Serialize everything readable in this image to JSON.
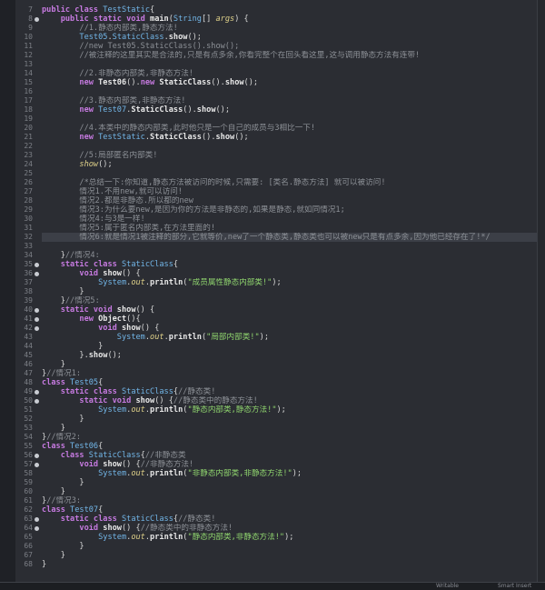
{
  "lines": [
    {
      "n": "7",
      "fold": false,
      "tokens": [
        [
          "kw",
          "public class "
        ],
        [
          "cls",
          "TestStatic"
        ],
        [
          "",
          "{"
        ]
      ]
    },
    {
      "n": "8",
      "fold": true,
      "tokens": [
        [
          "",
          "    "
        ],
        [
          "kw",
          "public static void "
        ],
        [
          "fn",
          "main"
        ],
        [
          "",
          "("
        ],
        [
          "cls",
          "String"
        ],
        [
          "",
          "[] "
        ],
        [
          "it",
          "args"
        ],
        [
          "",
          ") {"
        ]
      ]
    },
    {
      "n": "9",
      "fold": false,
      "tokens": [
        [
          "",
          "        "
        ],
        [
          "cm",
          "//1.静态内部类,静态方法!"
        ]
      ]
    },
    {
      "n": "10",
      "fold": false,
      "tokens": [
        [
          "",
          "        "
        ],
        [
          "cls",
          "Test05"
        ],
        [
          "",
          "."
        ],
        [
          "cls",
          "StaticClass"
        ],
        [
          "",
          "."
        ],
        [
          "fn",
          "show"
        ],
        [
          "",
          "();"
        ]
      ]
    },
    {
      "n": "11",
      "fold": false,
      "tokens": [
        [
          "",
          "        "
        ],
        [
          "cm",
          "//new Test05.StaticClass().show();"
        ]
      ]
    },
    {
      "n": "12",
      "fold": false,
      "tokens": [
        [
          "",
          "        "
        ],
        [
          "cm",
          "//被注释的这里其实是合法的,只是有点多余,你看完整个在回头看这里,这与调用静态方法有连带!"
        ]
      ]
    },
    {
      "n": "13",
      "fold": false,
      "tokens": []
    },
    {
      "n": "14",
      "fold": false,
      "tokens": [
        [
          "",
          "        "
        ],
        [
          "cm",
          "//2.非静态内部类,非静态方法!"
        ]
      ]
    },
    {
      "n": "15",
      "fold": false,
      "tokens": [
        [
          "",
          "        "
        ],
        [
          "kw",
          "new "
        ],
        [
          "fn",
          "Test06"
        ],
        [
          "",
          "()."
        ],
        [
          "kw",
          "new "
        ],
        [
          "fn",
          "StaticClass"
        ],
        [
          "",
          "()."
        ],
        [
          "fn",
          "show"
        ],
        [
          "",
          "();"
        ]
      ]
    },
    {
      "n": "16",
      "fold": false,
      "tokens": []
    },
    {
      "n": "17",
      "fold": false,
      "tokens": [
        [
          "",
          "        "
        ],
        [
          "cm",
          "//3.静态内部类,非静态方法!"
        ]
      ]
    },
    {
      "n": "18",
      "fold": false,
      "tokens": [
        [
          "",
          "        "
        ],
        [
          "kw",
          "new "
        ],
        [
          "cls",
          "Test07"
        ],
        [
          "",
          "."
        ],
        [
          "fn",
          "StaticClass"
        ],
        [
          "",
          "()."
        ],
        [
          "fn",
          "show"
        ],
        [
          "",
          "();"
        ]
      ]
    },
    {
      "n": "19",
      "fold": false,
      "tokens": []
    },
    {
      "n": "20",
      "fold": false,
      "tokens": [
        [
          "",
          "        "
        ],
        [
          "cm",
          "//4.本类中的静态内部类,此时他只是一个自己的成员与3相比一下!"
        ]
      ]
    },
    {
      "n": "21",
      "fold": false,
      "tokens": [
        [
          "",
          "        "
        ],
        [
          "kw",
          "new "
        ],
        [
          "cls",
          "TestStatic"
        ],
        [
          "",
          "."
        ],
        [
          "fn",
          "StaticClass"
        ],
        [
          "",
          "()."
        ],
        [
          "fn",
          "show"
        ],
        [
          "",
          "();"
        ]
      ]
    },
    {
      "n": "22",
      "fold": false,
      "tokens": []
    },
    {
      "n": "23",
      "fold": false,
      "tokens": [
        [
          "",
          "        "
        ],
        [
          "cm",
          "//5:局部匿名内部类!"
        ]
      ]
    },
    {
      "n": "24",
      "fold": false,
      "tokens": [
        [
          "",
          "        "
        ],
        [
          "it",
          "show"
        ],
        [
          "",
          "();"
        ]
      ]
    },
    {
      "n": "25",
      "fold": false,
      "tokens": []
    },
    {
      "n": "26",
      "fold": false,
      "tokens": [
        [
          "",
          "        "
        ],
        [
          "cm",
          "/*总结一下:你知道,静态方法被访问的时候,只需要: [类名.静态方法] 就可以被访问!"
        ]
      ]
    },
    {
      "n": "27",
      "fold": false,
      "tokens": [
        [
          "",
          "        "
        ],
        [
          "cm",
          "情况1.不用new,就可以访问!"
        ]
      ]
    },
    {
      "n": "28",
      "fold": false,
      "tokens": [
        [
          "",
          "        "
        ],
        [
          "cm",
          "情况2.都是非静态.所以都的new"
        ]
      ]
    },
    {
      "n": "29",
      "fold": false,
      "tokens": [
        [
          "",
          "        "
        ],
        [
          "cm",
          "情况3:为什么要new,是因为你的方法是非静态的,如果是静态,就如同情况1;"
        ]
      ]
    },
    {
      "n": "30",
      "fold": false,
      "tokens": [
        [
          "",
          "        "
        ],
        [
          "cm",
          "情况4:与3是一样!"
        ]
      ]
    },
    {
      "n": "31",
      "fold": false,
      "tokens": [
        [
          "",
          "        "
        ],
        [
          "cm",
          "情况5:属于匿名内部类,在方法里面的!"
        ]
      ]
    },
    {
      "n": "32",
      "fold": false,
      "hl": true,
      "tokens": [
        [
          "",
          "        "
        ],
        [
          "cm",
          "情况6:就是情况1被注释的部分,它就等价,new了一个静态类,静态类也可以被new只是有点多余,因为他已经存在了!*/"
        ]
      ]
    },
    {
      "n": "33",
      "fold": false,
      "tokens": []
    },
    {
      "n": "34",
      "fold": false,
      "tokens": [
        [
          "",
          "    }"
        ],
        [
          "cm",
          "//情况4:"
        ]
      ]
    },
    {
      "n": "35",
      "fold": true,
      "tokens": [
        [
          "",
          "    "
        ],
        [
          "kw",
          "static class "
        ],
        [
          "cls",
          "StaticClass"
        ],
        [
          "",
          "{"
        ]
      ]
    },
    {
      "n": "36",
      "fold": true,
      "tokens": [
        [
          "",
          "        "
        ],
        [
          "kw",
          "void "
        ],
        [
          "fn",
          "show"
        ],
        [
          "",
          "() {"
        ]
      ]
    },
    {
      "n": "37",
      "fold": false,
      "tokens": [
        [
          "",
          "            "
        ],
        [
          "cls",
          "System"
        ],
        [
          "",
          "."
        ],
        [
          "it",
          "out"
        ],
        [
          "",
          "."
        ],
        [
          "fn",
          "println"
        ],
        [
          "",
          "("
        ],
        [
          "st",
          "\"成员属性静态内部类!\""
        ],
        [
          "",
          ");"
        ]
      ]
    },
    {
      "n": "38",
      "fold": false,
      "tokens": [
        [
          "",
          "        }"
        ]
      ]
    },
    {
      "n": "39",
      "fold": false,
      "tokens": [
        [
          "",
          "    }"
        ],
        [
          "cm",
          "//情况5:"
        ]
      ]
    },
    {
      "n": "40",
      "fold": true,
      "tokens": [
        [
          "",
          "    "
        ],
        [
          "kw",
          "static void "
        ],
        [
          "fn",
          "show"
        ],
        [
          "",
          "() {"
        ]
      ]
    },
    {
      "n": "41",
      "fold": true,
      "tokens": [
        [
          "",
          "        "
        ],
        [
          "kw",
          "new "
        ],
        [
          "fn",
          "Object"
        ],
        [
          "",
          "(){"
        ]
      ]
    },
    {
      "n": "42",
      "fold": true,
      "tokens": [
        [
          "",
          "            "
        ],
        [
          "kw",
          "void "
        ],
        [
          "fn",
          "show"
        ],
        [
          "",
          "() {"
        ]
      ]
    },
    {
      "n": "43",
      "fold": false,
      "tokens": [
        [
          "",
          "                "
        ],
        [
          "cls",
          "System"
        ],
        [
          "",
          "."
        ],
        [
          "it",
          "out"
        ],
        [
          "",
          "."
        ],
        [
          "fn",
          "println"
        ],
        [
          "",
          "("
        ],
        [
          "st",
          "\"局部内部类!\""
        ],
        [
          "",
          ");"
        ]
      ]
    },
    {
      "n": "44",
      "fold": false,
      "tokens": [
        [
          "",
          "            }"
        ]
      ]
    },
    {
      "n": "45",
      "fold": false,
      "tokens": [
        [
          "",
          "        }."
        ],
        [
          "fn",
          "show"
        ],
        [
          "",
          "();"
        ]
      ]
    },
    {
      "n": "46",
      "fold": false,
      "tokens": [
        [
          "",
          "    }"
        ]
      ]
    },
    {
      "n": "47",
      "fold": false,
      "tokens": [
        [
          "",
          "}"
        ],
        [
          "cm",
          "//情况1:"
        ]
      ]
    },
    {
      "n": "48",
      "fold": false,
      "tokens": [
        [
          "kw",
          "class "
        ],
        [
          "cls",
          "Test05"
        ],
        [
          "",
          "{"
        ]
      ]
    },
    {
      "n": "49",
      "fold": true,
      "tokens": [
        [
          "",
          "    "
        ],
        [
          "kw",
          "static class "
        ],
        [
          "cls",
          "StaticClass"
        ],
        [
          "",
          "{"
        ],
        [
          "cm",
          "//静态类!"
        ]
      ]
    },
    {
      "n": "50",
      "fold": true,
      "tokens": [
        [
          "",
          "        "
        ],
        [
          "kw",
          "static void "
        ],
        [
          "fn",
          "show"
        ],
        [
          "",
          "() {"
        ],
        [
          "cm",
          "//静态类中的静态方法!"
        ]
      ]
    },
    {
      "n": "51",
      "fold": false,
      "tokens": [
        [
          "",
          "            "
        ],
        [
          "cls",
          "System"
        ],
        [
          "",
          "."
        ],
        [
          "it",
          "out"
        ],
        [
          "",
          "."
        ],
        [
          "fn",
          "println"
        ],
        [
          "",
          "("
        ],
        [
          "st",
          "\"静态内部类,静态方法!\""
        ],
        [
          "",
          ");"
        ]
      ]
    },
    {
      "n": "52",
      "fold": false,
      "tokens": [
        [
          "",
          "        }"
        ]
      ]
    },
    {
      "n": "53",
      "fold": false,
      "tokens": [
        [
          "",
          "    }"
        ]
      ]
    },
    {
      "n": "54",
      "fold": false,
      "tokens": [
        [
          "",
          "}"
        ],
        [
          "cm",
          "//情况2:"
        ]
      ]
    },
    {
      "n": "55",
      "fold": false,
      "tokens": [
        [
          "kw",
          "class "
        ],
        [
          "cls",
          "Test06"
        ],
        [
          "",
          "{"
        ]
      ]
    },
    {
      "n": "56",
      "fold": true,
      "tokens": [
        [
          "",
          "    "
        ],
        [
          "kw",
          "class "
        ],
        [
          "cls",
          "StaticClass"
        ],
        [
          "",
          "{"
        ],
        [
          "cm",
          "//非静态类"
        ]
      ]
    },
    {
      "n": "57",
      "fold": true,
      "tokens": [
        [
          "",
          "        "
        ],
        [
          "kw",
          "void "
        ],
        [
          "fn",
          "show"
        ],
        [
          "",
          "() {"
        ],
        [
          "cm",
          "//非静态方法!"
        ]
      ]
    },
    {
      "n": "58",
      "fold": false,
      "tokens": [
        [
          "",
          "            "
        ],
        [
          "cls",
          "System"
        ],
        [
          "",
          "."
        ],
        [
          "it",
          "out"
        ],
        [
          "",
          "."
        ],
        [
          "fn",
          "println"
        ],
        [
          "",
          "("
        ],
        [
          "st",
          "\"非静态内部类,非静态方法!\""
        ],
        [
          "",
          ");"
        ]
      ]
    },
    {
      "n": "59",
      "fold": false,
      "tokens": [
        [
          "",
          "        }"
        ]
      ]
    },
    {
      "n": "60",
      "fold": false,
      "tokens": [
        [
          "",
          "    }"
        ]
      ]
    },
    {
      "n": "61",
      "fold": false,
      "tokens": [
        [
          "",
          "}"
        ],
        [
          "cm",
          "//情况3:"
        ]
      ]
    },
    {
      "n": "62",
      "fold": false,
      "tokens": [
        [
          "kw",
          "class "
        ],
        [
          "cls",
          "Test07"
        ],
        [
          "",
          "{"
        ]
      ]
    },
    {
      "n": "63",
      "fold": true,
      "tokens": [
        [
          "",
          "    "
        ],
        [
          "kw",
          "static class "
        ],
        [
          "cls",
          "StaticClass"
        ],
        [
          "",
          "{"
        ],
        [
          "cm",
          "//静态类!"
        ]
      ]
    },
    {
      "n": "64",
      "fold": true,
      "tokens": [
        [
          "",
          "        "
        ],
        [
          "kw",
          "void "
        ],
        [
          "fn",
          "show"
        ],
        [
          "",
          "() {"
        ],
        [
          "cm",
          "//静态类中的非静态方法!"
        ]
      ]
    },
    {
      "n": "65",
      "fold": false,
      "tokens": [
        [
          "",
          "            "
        ],
        [
          "cls",
          "System"
        ],
        [
          "",
          "."
        ],
        [
          "it",
          "out"
        ],
        [
          "",
          "."
        ],
        [
          "fn",
          "println"
        ],
        [
          "",
          "("
        ],
        [
          "st",
          "\"静态内部类,非静态方法!\""
        ],
        [
          "",
          ");"
        ]
      ]
    },
    {
      "n": "66",
      "fold": false,
      "tokens": [
        [
          "",
          "        }"
        ]
      ]
    },
    {
      "n": "67",
      "fold": false,
      "tokens": [
        [
          "",
          "    }"
        ]
      ]
    },
    {
      "n": "68",
      "fold": false,
      "tokens": [
        [
          "",
          "}"
        ]
      ]
    }
  ],
  "status": {
    "left": "Writable",
    "right": "Smart Insert"
  }
}
